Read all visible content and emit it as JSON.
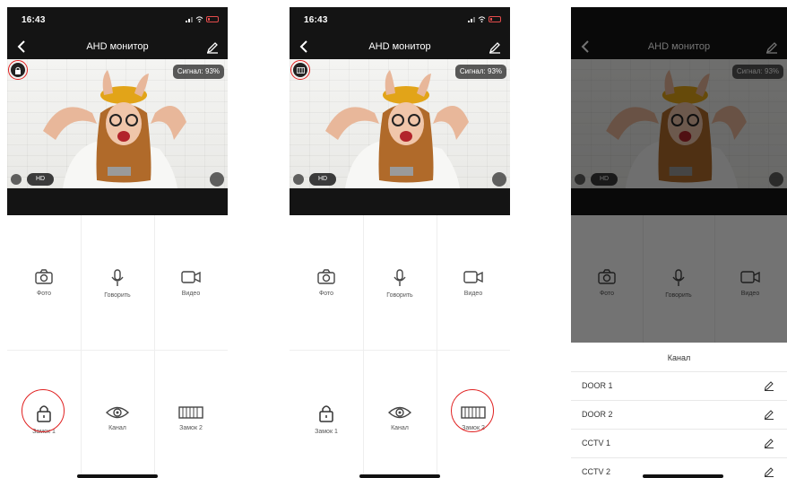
{
  "status": {
    "time": "16:43"
  },
  "nav": {
    "title": "AHD монитор"
  },
  "video": {
    "signal_label": "Сигнал: 93%",
    "quality_label": "HD"
  },
  "controls": {
    "photo": "Фото",
    "talk": "Говорить",
    "video": "Видео",
    "lock1": "Замок 1",
    "channel": "Канал",
    "lock2": "Замок 2"
  },
  "sheet": {
    "title": "Канал",
    "items": [
      "DOOR 1",
      "DOOR 2",
      "CCTV 1",
      "CCTV 2"
    ]
  },
  "colors": {
    "highlight": "#e02020",
    "bar": "#141414"
  }
}
